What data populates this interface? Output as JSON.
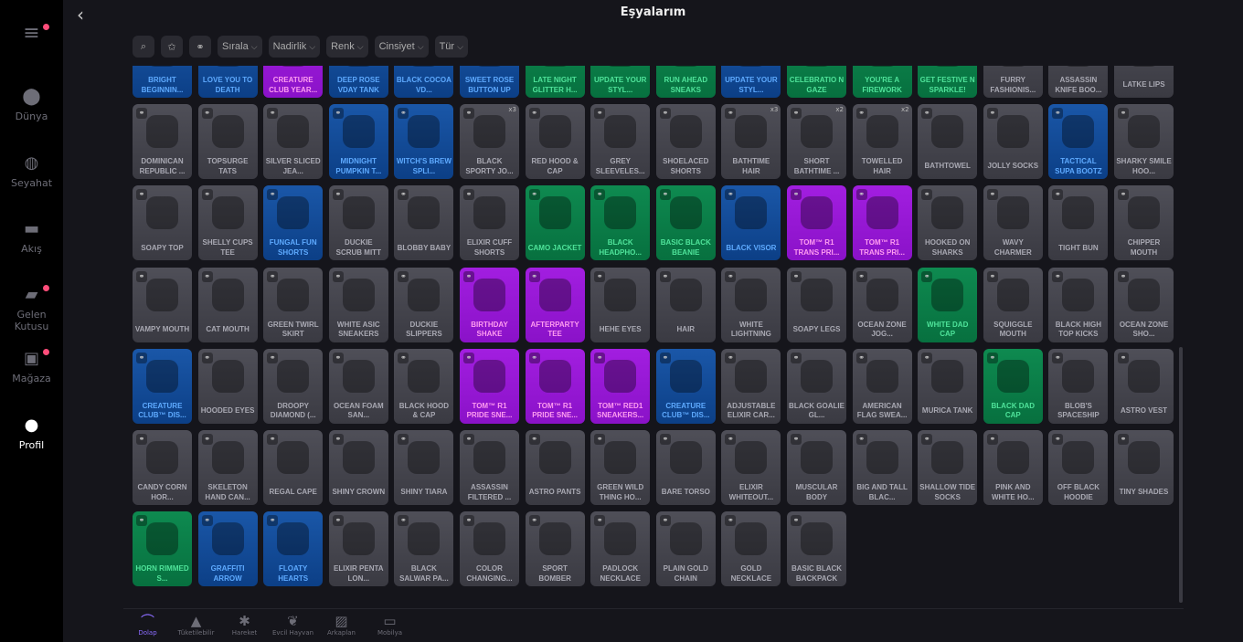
{
  "header": {
    "title": "Eşyalarım",
    "back": "‹"
  },
  "sidebar": {
    "items": [
      {
        "label": "",
        "icon": "≡",
        "name": "menu",
        "dot": true
      },
      {
        "label": "Dünya",
        "icon": "⬤",
        "name": "world",
        "dot": false
      },
      {
        "label": "Seyahat",
        "icon": "◍",
        "name": "travel",
        "dot": false
      },
      {
        "label": "Akış",
        "icon": "▬",
        "name": "feed",
        "dot": false
      },
      {
        "label": "Gelen Kutusu",
        "icon": "▰",
        "name": "inbox",
        "dot": true
      },
      {
        "label": "Mağaza",
        "icon": "▣",
        "name": "store",
        "dot": true
      },
      {
        "label": "Profil",
        "icon": "●",
        "name": "profile",
        "dot": false,
        "active": true
      }
    ]
  },
  "filters": {
    "search_icon": "⌕",
    "fav_icon": "✩",
    "link_icon": "⚭",
    "sort": "Sırala",
    "rarity": "Nadirlik",
    "color": "Renk",
    "gender": "Cinsiyet",
    "type": "Tür"
  },
  "colors": {
    "common": "#4a4a53",
    "rare": "#1450a0",
    "epic": "#9a18d6",
    "uncommon": "#0b7d48",
    "accent": "#8b6cff"
  },
  "items": [
    [
      [
        "BRIGHT BEGINNIN...",
        "b"
      ],
      [
        "LOVE YOU TO DEATH",
        "b"
      ],
      [
        "CREATURE CLUB YEAR...",
        "p"
      ],
      [
        "DEEP ROSE VDAY TANK",
        "b"
      ],
      [
        "BLACK COCOA VD...",
        "b"
      ],
      [
        "SWEET ROSE BUTTON UP",
        "b"
      ],
      [
        "LATE NIGHT GLITTER H...",
        "gr"
      ],
      [
        "UPDATE YOUR STYL...",
        "gr"
      ],
      [
        "RUN AHEAD SNEAKS",
        "gr"
      ],
      [
        "UPDATE YOUR STYL...",
        "b"
      ],
      [
        "CELEBRATIO N GAZE",
        "gr"
      ],
      [
        "YOU'RE A FIREWORK",
        "gr"
      ],
      [
        "GET FESTIVE N SPARKLE!",
        "gr"
      ],
      [
        "FURRY FASHIONIS...",
        "g"
      ],
      [
        "ASSASSIN KNIFE BOO...",
        "g"
      ],
      [
        "LATKE LIPS",
        "g"
      ]
    ],
    [
      [
        "DOMINICAN REPUBLIC ...",
        "g"
      ],
      [
        "TOPSURGE TATS",
        "g"
      ],
      [
        "SILVER SLICED JEA...",
        "g"
      ],
      [
        "MIDNIGHT PUMPKIN T...",
        "b"
      ],
      [
        "WITCH'S BREW SPLI...",
        "b"
      ],
      [
        "BLACK SPORTY JO...",
        "g",
        "x3"
      ],
      [
        "RED HOOD & CAP",
        "g"
      ],
      [
        "GREY SLEEVELES...",
        "g"
      ],
      [
        "SHOELACED SHORTS",
        "g"
      ],
      [
        "BATHTIME HAIR",
        "g",
        "x3"
      ],
      [
        "SHORT BATHTIME ...",
        "g",
        "x2"
      ],
      [
        "TOWELLED HAIR",
        "g",
        "x2"
      ],
      [
        "BATHTOWEL",
        "g"
      ],
      [
        "JOLLY SOCKS",
        "g"
      ],
      [
        "TACTICAL SUPA BOOTZ",
        "b"
      ],
      [
        "SHARKY SMILE HOO...",
        "g"
      ]
    ],
    [
      [
        "SOAPY TOP",
        "g"
      ],
      [
        "SHELLY CUPS TEE",
        "g"
      ],
      [
        "FUNGAL FUN SHORTS",
        "b"
      ],
      [
        "DUCKIE SCRUB MITT",
        "g"
      ],
      [
        "BLOBBY BABY",
        "g"
      ],
      [
        "ELIXIR CUFF SHORTS",
        "g"
      ],
      [
        "CAMO JACKET",
        "gr"
      ],
      [
        "BLACK HEADPHO...",
        "gr"
      ],
      [
        "BASIC BLACK BEANIE",
        "gr"
      ],
      [
        "BLACK VISOR",
        "b"
      ],
      [
        "TOM™ R1 TRANS PRI...",
        "p"
      ],
      [
        "TOM™ R1 TRANS PRI...",
        "p"
      ],
      [
        "HOOKED ON SHARKS",
        "g"
      ],
      [
        "WAVY CHARMER",
        "g"
      ],
      [
        "TIGHT BUN",
        "g"
      ],
      [
        "CHIPPER MOUTH",
        "g"
      ]
    ],
    [
      [
        "VAMPY MOUTH",
        "g"
      ],
      [
        "CAT MOUTH",
        "g"
      ],
      [
        "GREEN TWIRL SKIRT",
        "g"
      ],
      [
        "WHITE ASIC SNEAKERS",
        "g"
      ],
      [
        "DUCKIE SLIPPERS",
        "g"
      ],
      [
        "BIRTHDAY SHAKE",
        "p"
      ],
      [
        "AFTERPARTY TEE",
        "p"
      ],
      [
        "HEHE EYES",
        "g"
      ],
      [
        "HAIR",
        "g"
      ],
      [
        "WHITE LIGHTNING",
        "g"
      ],
      [
        "SOAPY LEGS",
        "g"
      ],
      [
        "OCEAN ZONE JOG...",
        "g"
      ],
      [
        "WHITE DAD CAP",
        "gr"
      ],
      [
        "SQUIGGLE MOUTH",
        "g"
      ],
      [
        "BLACK HIGH TOP KICKS",
        "g"
      ],
      [
        "OCEAN ZONE SHO...",
        "g"
      ]
    ],
    [
      [
        "CREATURE CLUB™ DIS...",
        "b"
      ],
      [
        "HOODED EYES",
        "g"
      ],
      [
        "DROOPY DIAMOND (...",
        "g"
      ],
      [
        "OCEAN FOAM SAN...",
        "g"
      ],
      [
        "BLACK HOOD & CAP",
        "g"
      ],
      [
        "TOM™ R1 PRIDE SNE...",
        "p"
      ],
      [
        "TOM™ R1 PRIDE SNE...",
        "p"
      ],
      [
        "TOM™ RED1 SNEAKERS...",
        "p"
      ],
      [
        "CREATURE CLUB™ DIS...",
        "b"
      ],
      [
        "ADJUSTABLE ELIXIR CAR...",
        "g"
      ],
      [
        "BLACK GOALIE GL...",
        "g"
      ],
      [
        "AMERICAN FLAG SWEA...",
        "g"
      ],
      [
        "MURICA TANK",
        "g"
      ],
      [
        "BLACK DAD CAP",
        "gr"
      ],
      [
        "BLOB'S SPACESHIP",
        "g"
      ],
      [
        "ASTRO VEST",
        "g"
      ]
    ],
    [
      [
        "CANDY CORN HOR...",
        "g"
      ],
      [
        "SKELETON HAND CAN...",
        "g"
      ],
      [
        "REGAL CAPE",
        "g"
      ],
      [
        "SHINY CROWN",
        "g"
      ],
      [
        "SHINY TIARA",
        "g"
      ],
      [
        "ASSASSIN FILTERED ...",
        "g"
      ],
      [
        "ASTRO PANTS",
        "g"
      ],
      [
        "GREEN WILD THING HO...",
        "g"
      ],
      [
        "BARE TORSO",
        "g"
      ],
      [
        "ELIXIR WHITEOUT...",
        "g"
      ],
      [
        "MUSCULAR BODY",
        "g"
      ],
      [
        "BIG AND TALL BLAC...",
        "g"
      ],
      [
        "SHALLOW TIDE SOCKS",
        "g"
      ],
      [
        "PINK AND WHITE HO...",
        "g"
      ],
      [
        "OFF BLACK HOODIE",
        "g"
      ],
      [
        "TINY SHADES",
        "g"
      ]
    ],
    [
      [
        "HORN RIMMED S...",
        "gr"
      ],
      [
        "GRAFFITI ARROW",
        "b"
      ],
      [
        "FLOATY HEARTS",
        "b"
      ],
      [
        "ELIXIR PENTA LON...",
        "g"
      ],
      [
        "BLACK SALWAR PA...",
        "g"
      ],
      [
        "COLOR CHANGING...",
        "g"
      ],
      [
        "SPORT BOMBER",
        "g"
      ],
      [
        "PADLOCK NECKLACE",
        "g"
      ],
      [
        "PLAIN GOLD CHAIN",
        "g"
      ],
      [
        "GOLD NECKLACE",
        "g"
      ],
      [
        "BASIC BLACK BACKPACK",
        "g"
      ]
    ]
  ],
  "bottom_tabs": [
    {
      "label": "Dolap",
      "icon": "⌒",
      "name": "closet",
      "active": true
    },
    {
      "label": "Tüketilebilir",
      "icon": "▲",
      "name": "consumables"
    },
    {
      "label": "Hareket",
      "icon": "✱",
      "name": "moves"
    },
    {
      "label": "Evcil Hayvan",
      "icon": "❦",
      "name": "pets"
    },
    {
      "label": "Arkaplan",
      "icon": "▨",
      "name": "backgrounds"
    },
    {
      "label": "Mobilya",
      "icon": "▭",
      "name": "furniture"
    }
  ]
}
